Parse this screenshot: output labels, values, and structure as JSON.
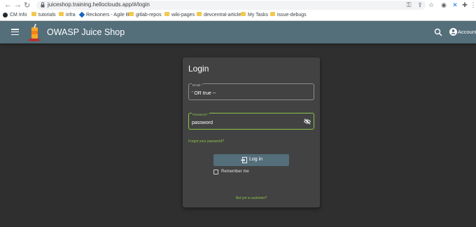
{
  "browser": {
    "url": "juiceshop.training.helloclouds.app/#/login",
    "bookmarks": [
      {
        "label": "CM Info",
        "icon": "github-icon"
      },
      {
        "label": "tutorials",
        "icon": "folder-icon"
      },
      {
        "label": "infra",
        "icon": "folder-icon"
      },
      {
        "label": "Reckoners - Agile B...",
        "icon": "diamond-icon"
      },
      {
        "label": "gitlab-repos",
        "icon": "folder-icon"
      },
      {
        "label": "wiki-pages",
        "icon": "folder-icon"
      },
      {
        "label": "devcentral-articles",
        "icon": "folder-icon"
      },
      {
        "label": "My Tasks",
        "icon": "folder-icon"
      },
      {
        "label": "issue-debugs",
        "icon": "folder-icon"
      }
    ]
  },
  "toolbar": {
    "app_title": "OWASP Juice Shop",
    "account_label": "Account"
  },
  "login": {
    "title": "Login",
    "email_label": "Email *",
    "email_value": "' OR true --",
    "password_label": "Password *",
    "password_value": "password",
    "forgot_link": "Forgot your password?",
    "login_button": "Log in",
    "remember_me": "Remember me",
    "not_customer": "Not yet a customer?"
  },
  "colors": {
    "toolbar": "#546e7a",
    "accent": "#8bc34a",
    "card": "#424242",
    "background": "#2f2f2f"
  }
}
